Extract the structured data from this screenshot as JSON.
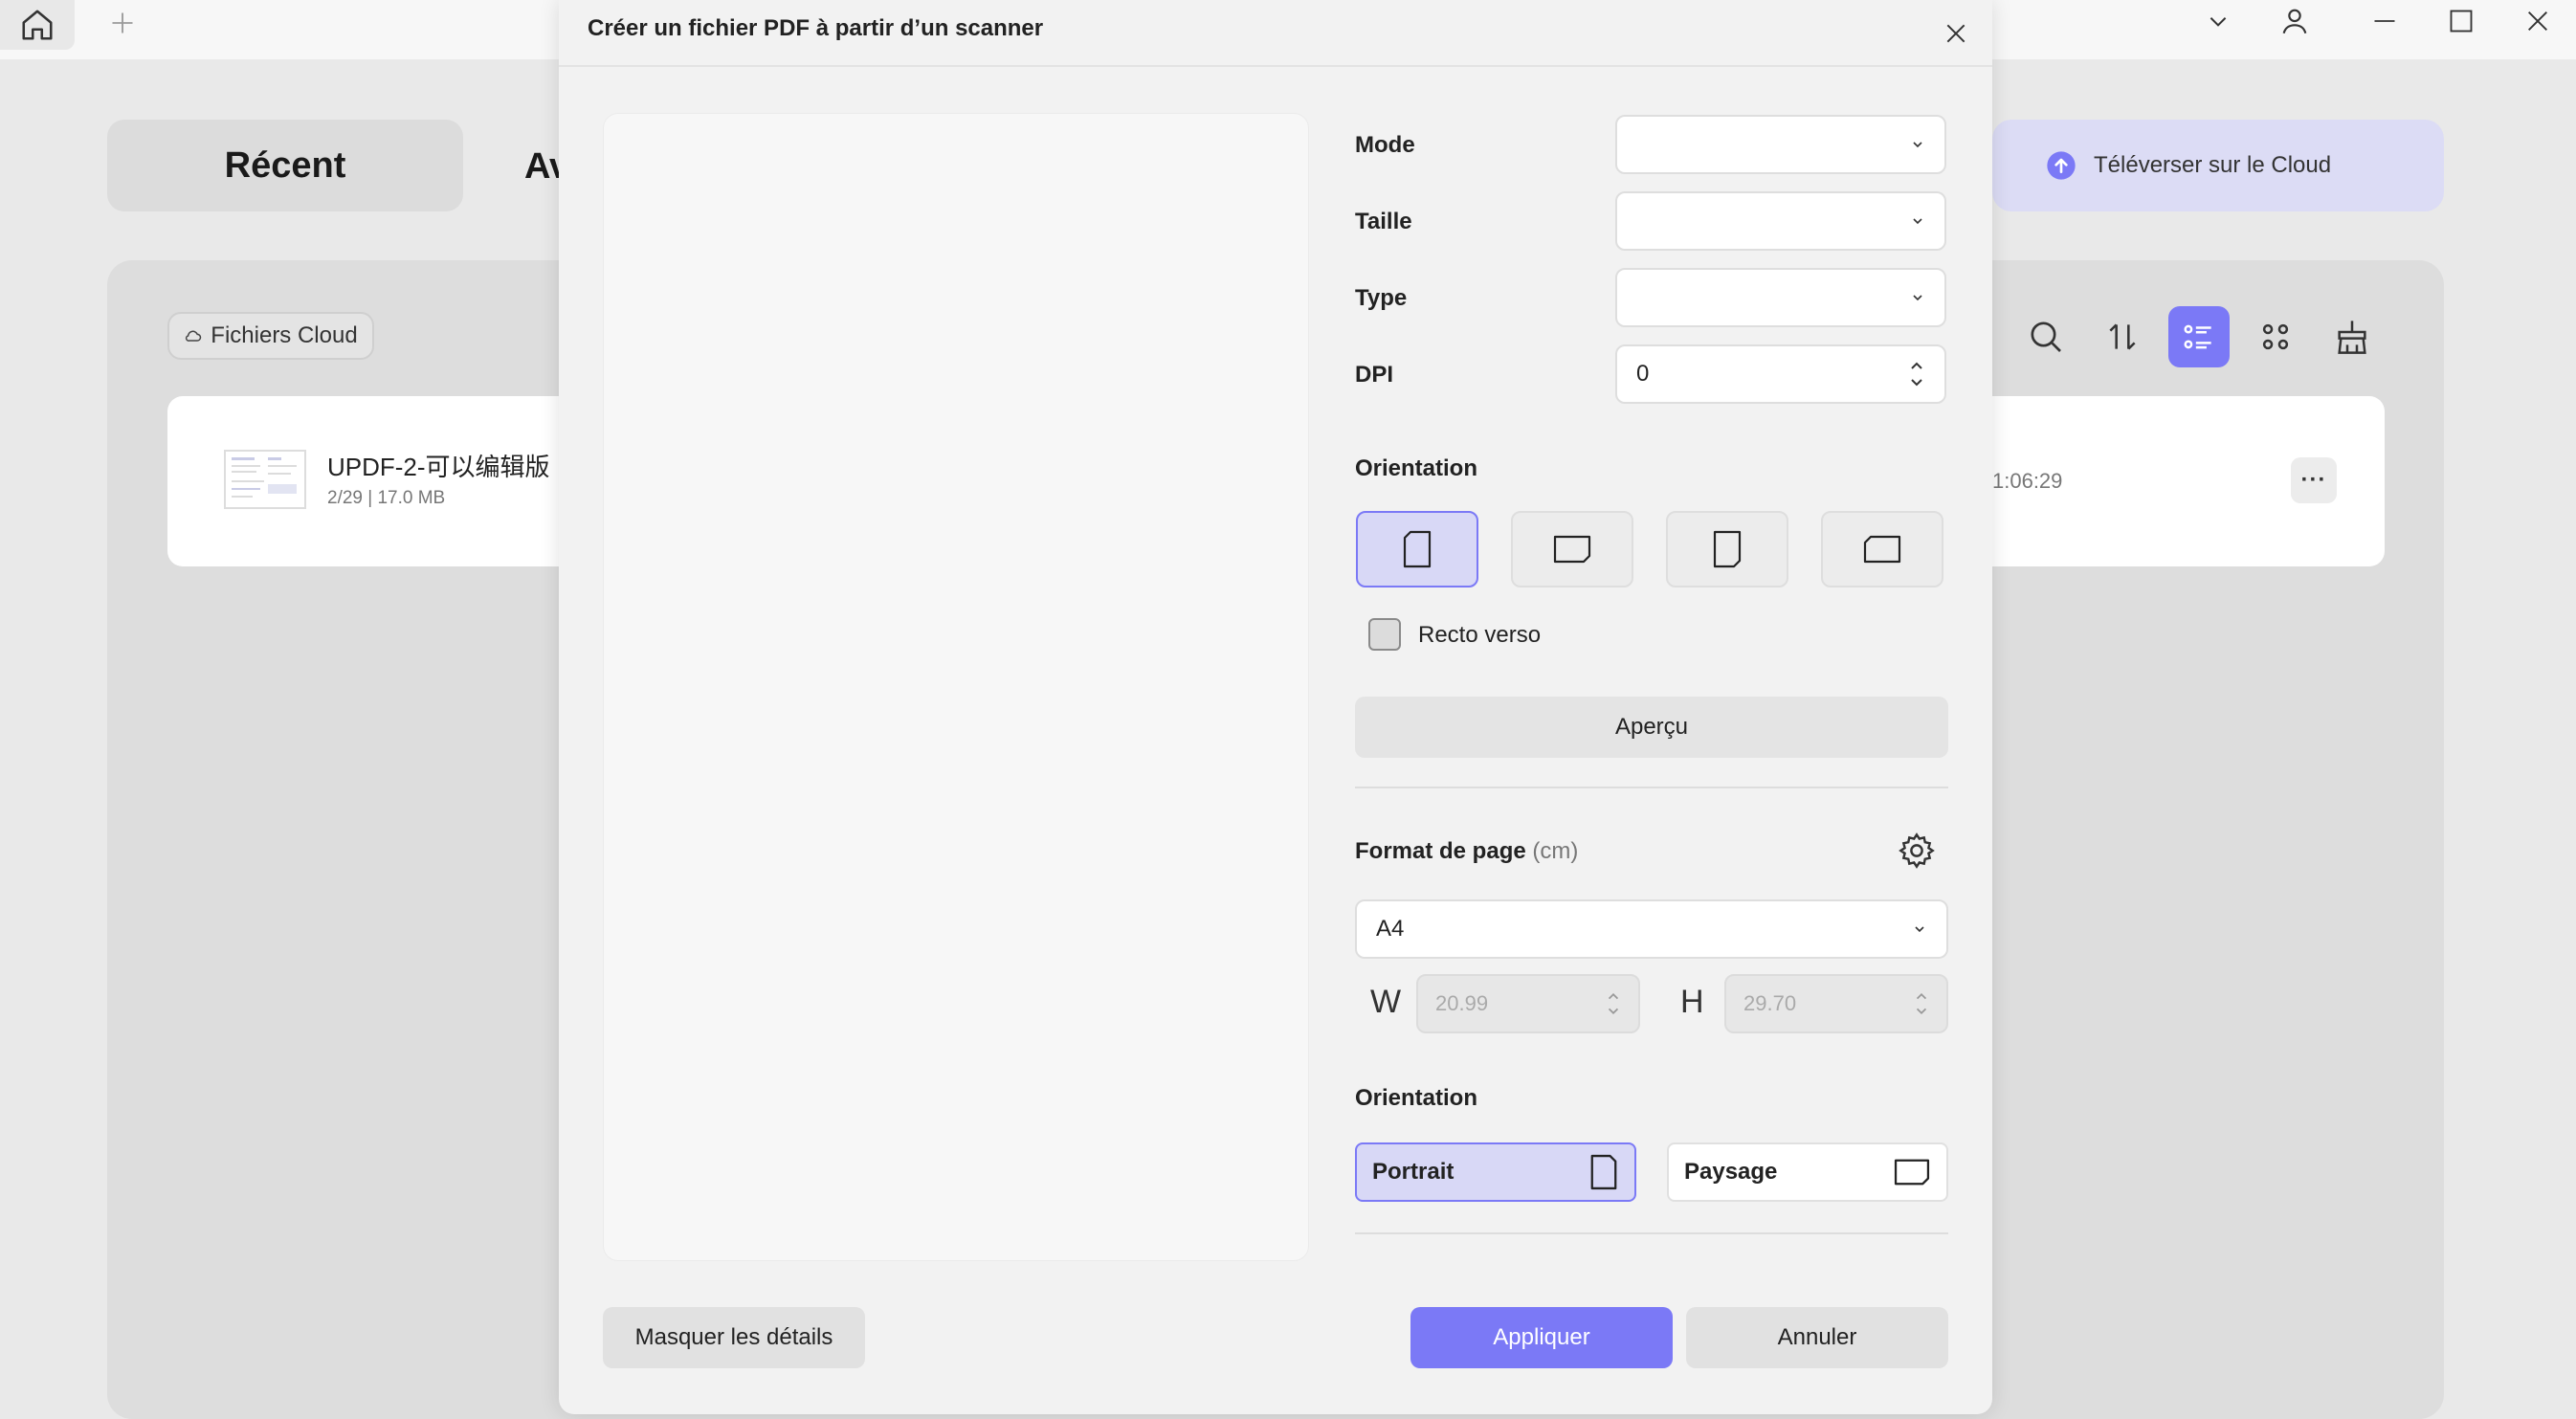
{
  "app": {
    "recent_tab": "Récent",
    "other_tab_partial": "Av",
    "cloud_upload_label": "Téléverser sur le Cloud",
    "cloud_files_label": "Fichiers Cloud",
    "file": {
      "name": "UPDF-2-可以编辑版",
      "meta": "2/29 | 17.0 MB",
      "time_partial": "1:06:29",
      "more_label": "···"
    }
  },
  "dialog": {
    "title": "Créer un fichier PDF à partir d’un scanner",
    "fields": {
      "mode_label": "Mode",
      "mode_value": "",
      "size_label": "Taille",
      "size_value": "",
      "type_label": "Type",
      "type_value": "",
      "dpi_label": "DPI",
      "dpi_value": "0"
    },
    "scan_orientation_label": "Orientation",
    "duplex_label": "Recto verso",
    "duplex_checked": false,
    "preview_button": "Aperçu",
    "page_format_label": "Format de page",
    "page_format_unit": "(cm)",
    "page_format_value": "A4",
    "width_label": "W",
    "width_value": "20.99",
    "height_label": "H",
    "height_value": "29.70",
    "page_orientation_label": "Orientation",
    "portrait_label": "Portrait",
    "landscape_label": "Paysage",
    "selected_page_orientation": "Portrait",
    "hide_details_button": "Masquer les détails",
    "apply_button": "Appliquer",
    "cancel_button": "Annuler"
  },
  "colors": {
    "accent": "#7b79f6",
    "accent_light": "#d8d8f6",
    "background": "#e9e9e9",
    "dialog_bg": "#f2f2f2"
  }
}
